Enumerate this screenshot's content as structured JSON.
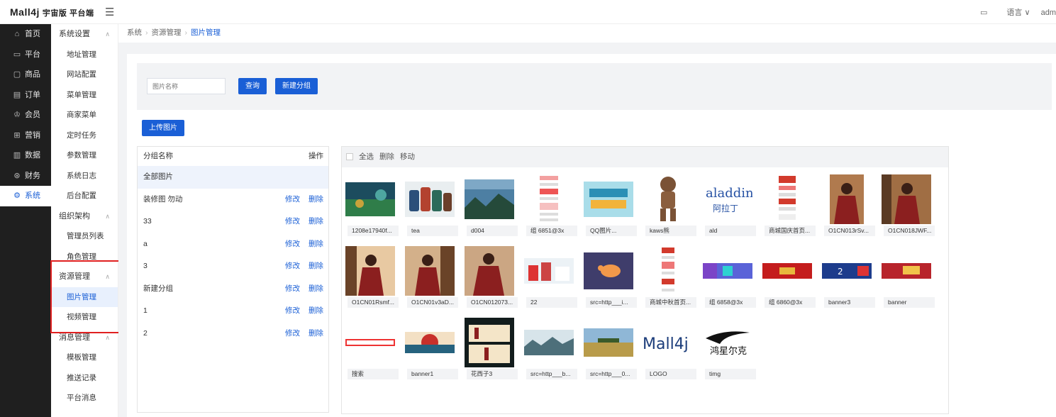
{
  "app": {
    "logo": "Mall4j",
    "edition": "宇宙版 平台端",
    "top_right": {
      "language": "语言",
      "user": "adm"
    }
  },
  "rail": [
    {
      "icon": "home-icon",
      "glyph": "⌂",
      "label": "首页"
    },
    {
      "icon": "monitor-icon",
      "glyph": "▭",
      "label": "平台"
    },
    {
      "icon": "bag-icon",
      "glyph": "▢",
      "label": "商品"
    },
    {
      "icon": "document-icon",
      "glyph": "▤",
      "label": "订单"
    },
    {
      "icon": "crown-icon",
      "glyph": "♔",
      "label": "会员"
    },
    {
      "icon": "gift-icon",
      "glyph": "⊞",
      "label": "营销"
    },
    {
      "icon": "bar-chart-icon",
      "glyph": "▥",
      "label": "数据"
    },
    {
      "icon": "money-icon",
      "glyph": "⊛",
      "label": "财务"
    },
    {
      "icon": "gear-icon",
      "glyph": "⚙",
      "label": "系统",
      "active": true
    }
  ],
  "submenu": {
    "system_settings": {
      "label": "系统设置",
      "items": [
        "地址管理",
        "网站配置",
        "菜单管理",
        "商家菜单",
        "定时任务",
        "参数管理",
        "系统日志",
        "后台配置"
      ]
    },
    "org": {
      "label": "组织架构",
      "items": [
        "管理员列表",
        "角色管理"
      ]
    },
    "resources": {
      "label": "资源管理",
      "items": [
        "图片管理",
        "视频管理"
      ]
    },
    "messages": {
      "label": "消息管理",
      "items": [
        "模板管理",
        "推送记录",
        "平台消息"
      ]
    }
  },
  "breadcrumb": {
    "l1": "系统",
    "l2": "资源管理",
    "l3": "图片管理"
  },
  "search": {
    "placeholder": "图片名称",
    "query_label": "查询",
    "new_group_label": "新建分组"
  },
  "upload_label": "上传图片",
  "groups": {
    "col_name": "分组名称",
    "col_op": "操作",
    "edit": "修改",
    "delete": "删除",
    "rows": [
      "全部图片",
      "装修图 勿动",
      "33",
      "a",
      "3",
      "新建分组",
      "1",
      "2"
    ]
  },
  "toolbar": {
    "select_all": "全选",
    "delete": "删除",
    "move": "移动"
  },
  "images": [
    "1208e17940f...",
    "tea",
    "d004",
    "组 6851@3x",
    "QQ图片...",
    "kaws熊",
    "ald",
    "商城国庆首页...",
    "O1CN013rSv...",
    "O1CN018JWF...",
    "O1CN01Rsmf...",
    "O1CN01v3aD...",
    "O1CN012073...",
    "22",
    "src=http___i...",
    "商城中秋首页...",
    "组 6858@3x",
    "组 6860@3x",
    "banner3",
    "banner",
    "搜索",
    "banner1",
    "花西子3",
    "src=http___b...",
    "src=http___0...",
    "LOGO",
    "timg"
  ],
  "colors": {
    "accent": "#1a5fd6",
    "rail_bg": "#1f1f1f",
    "highlight": "#e02020"
  }
}
